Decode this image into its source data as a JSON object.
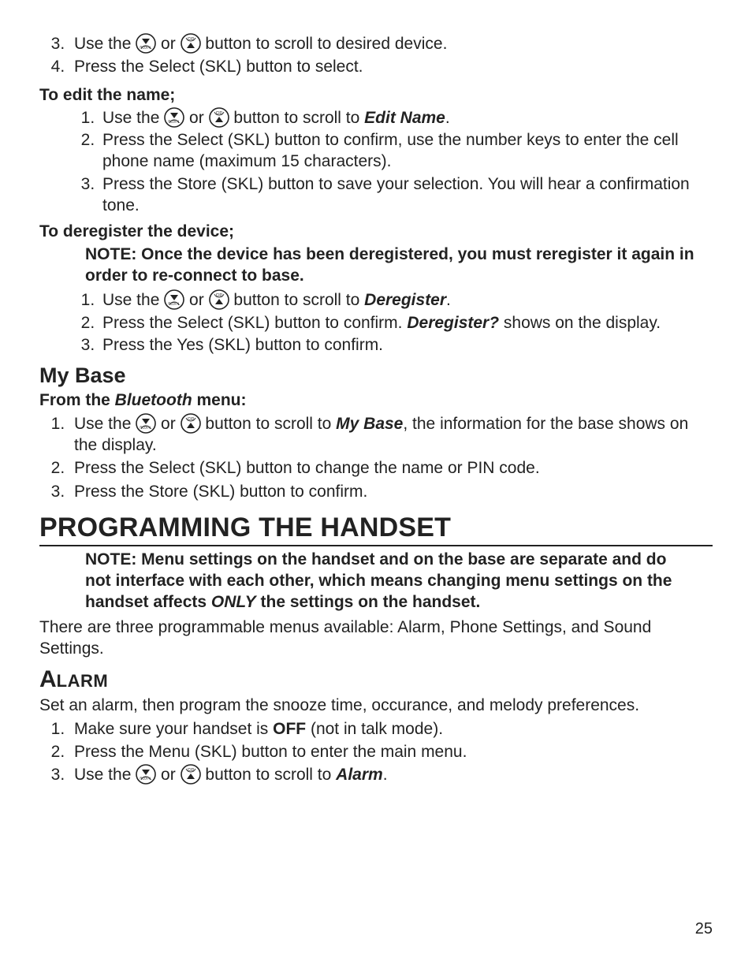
{
  "step3": {
    "pre": "Use the ",
    "mid": " or ",
    "post": " button to scroll to desired device."
  },
  "step4": "Press the Select (SKL) button to select.",
  "editTitle": "To edit the name;",
  "edit1": {
    "pre": "Use the ",
    "mid": " or ",
    "post_a": " button to scroll to ",
    "target": "Edit Name",
    "post_b": "."
  },
  "edit2": "Press the Select (SKL) button to confirm, use the number keys to enter the cell phone name (maximum 15 characters).",
  "edit3": "Press the Store (SKL) button to save your selection. You will hear a confirmation tone.",
  "deregTitle": "To deregister the device;",
  "deregNote": "NOTE: Once the device has been deregistered, you must reregister it again in order to re-connect to base.",
  "dereg1": {
    "pre": "Use the ",
    "mid": " or ",
    "post_a": " button to scroll to ",
    "target": "Deregister",
    "post_b": "."
  },
  "dereg2_a": "Press the Select (SKL) button to confirm. ",
  "dereg2_b": "Deregister?",
  "dereg2_c": " shows on the display.",
  "dereg3": "Press the Yes (SKL) button to confirm.",
  "mybaseTitle": "My Base",
  "fromBt_a": "From the ",
  "fromBt_b": "Bluetooth",
  "fromBt_c": " menu:",
  "mb1": {
    "pre": "Use the ",
    "mid": " or ",
    "post_a": " button to scroll to ",
    "target": "My Base",
    "post_b": ", the information for the base shows on the display."
  },
  "mb2": "Press the Select (SKL) button to change the name or PIN code.",
  "mb3": "Press the Store (SKL) button to confirm.",
  "progTitle": "PROGRAMMING THE HANDSET",
  "progNote_a": "NOTE: Menu settings on the handset and on the base are separate and do not interface with each other, which means changing menu settings on the handset affects ",
  "progNote_b": "ONLY",
  "progNote_c": " the settings on the handset.",
  "progPara": "There are three programmable menus available: Alarm, Phone Settings, and Sound Settings.",
  "alarm_big": "A",
  "alarm_small": "LARM",
  "alarmPara": "Set an alarm, then program the snooze time, occurance, and melody preferences.",
  "a1_a": "Make sure your handset is ",
  "a1_b": "OFF",
  "a1_c": " (not in talk mode).",
  "a2": "Press the Menu (SKL) button to enter the main menu.",
  "a3": {
    "pre": "Use the ",
    "mid": " or ",
    "post_a": " button to scroll to ",
    "target": "Alarm",
    "post_b": "."
  },
  "pageNum": "25"
}
